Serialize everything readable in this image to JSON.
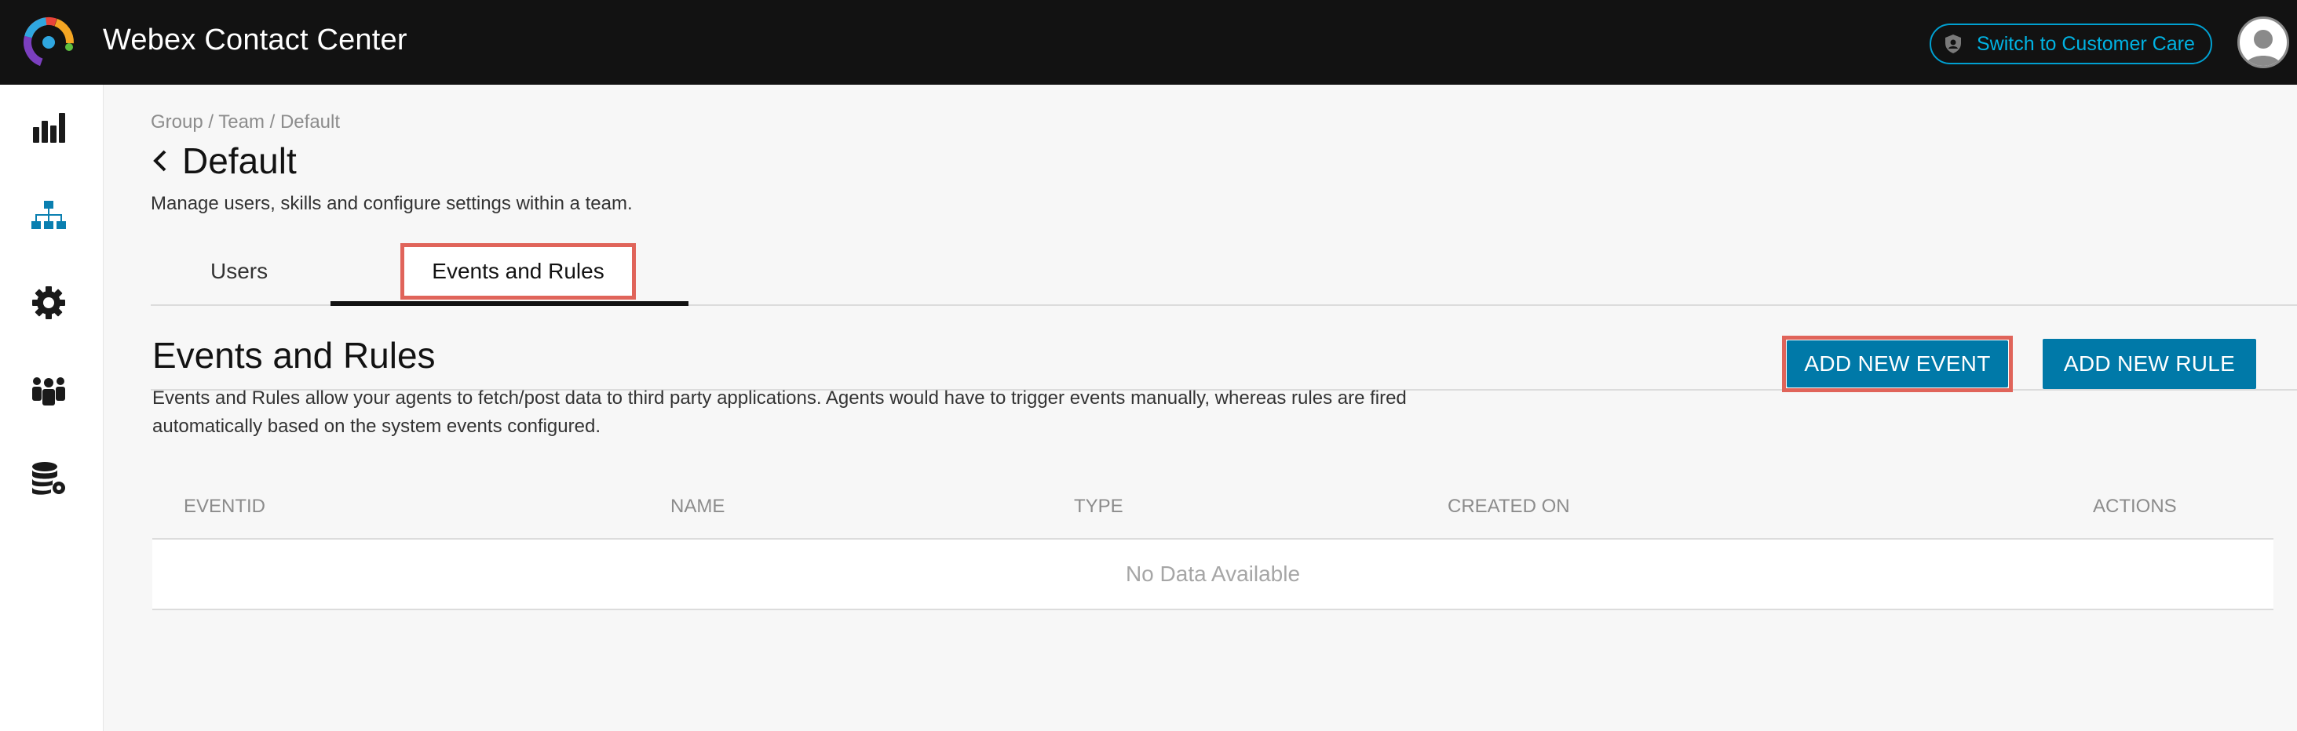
{
  "app": {
    "title": "Webex Contact Center",
    "switch_label": "Switch to Customer Care",
    "accent_color": "#0079a8",
    "highlight_color": "#e0645a"
  },
  "sidebar": {
    "items": [
      {
        "icon": "bar-chart-icon",
        "active": false
      },
      {
        "icon": "org-hierarchy-icon",
        "active": true
      },
      {
        "icon": "gear-icon",
        "active": false
      },
      {
        "icon": "people-icon",
        "active": false
      },
      {
        "icon": "database-gear-icon",
        "active": false
      }
    ]
  },
  "page": {
    "breadcrumb": "Group / Team / Default",
    "title": "Default",
    "description": "Manage users, skills and configure settings within a team."
  },
  "tabs": [
    {
      "label": "Users",
      "active": false
    },
    {
      "label": "Events and Rules",
      "active": true
    }
  ],
  "section": {
    "title": "Events and Rules",
    "description": "Events and Rules allow your agents to fetch/post data to third party applications. Agents would have to trigger events manually, whereas rules are fired automatically based on the system events configured."
  },
  "buttons": {
    "add_event": "ADD NEW EVENT",
    "add_rule": "ADD NEW RULE"
  },
  "table": {
    "columns": [
      "EVENTID",
      "NAME",
      "TYPE",
      "CREATED ON",
      "ACTIONS"
    ],
    "rows": [],
    "empty_text": "No Data Available"
  }
}
